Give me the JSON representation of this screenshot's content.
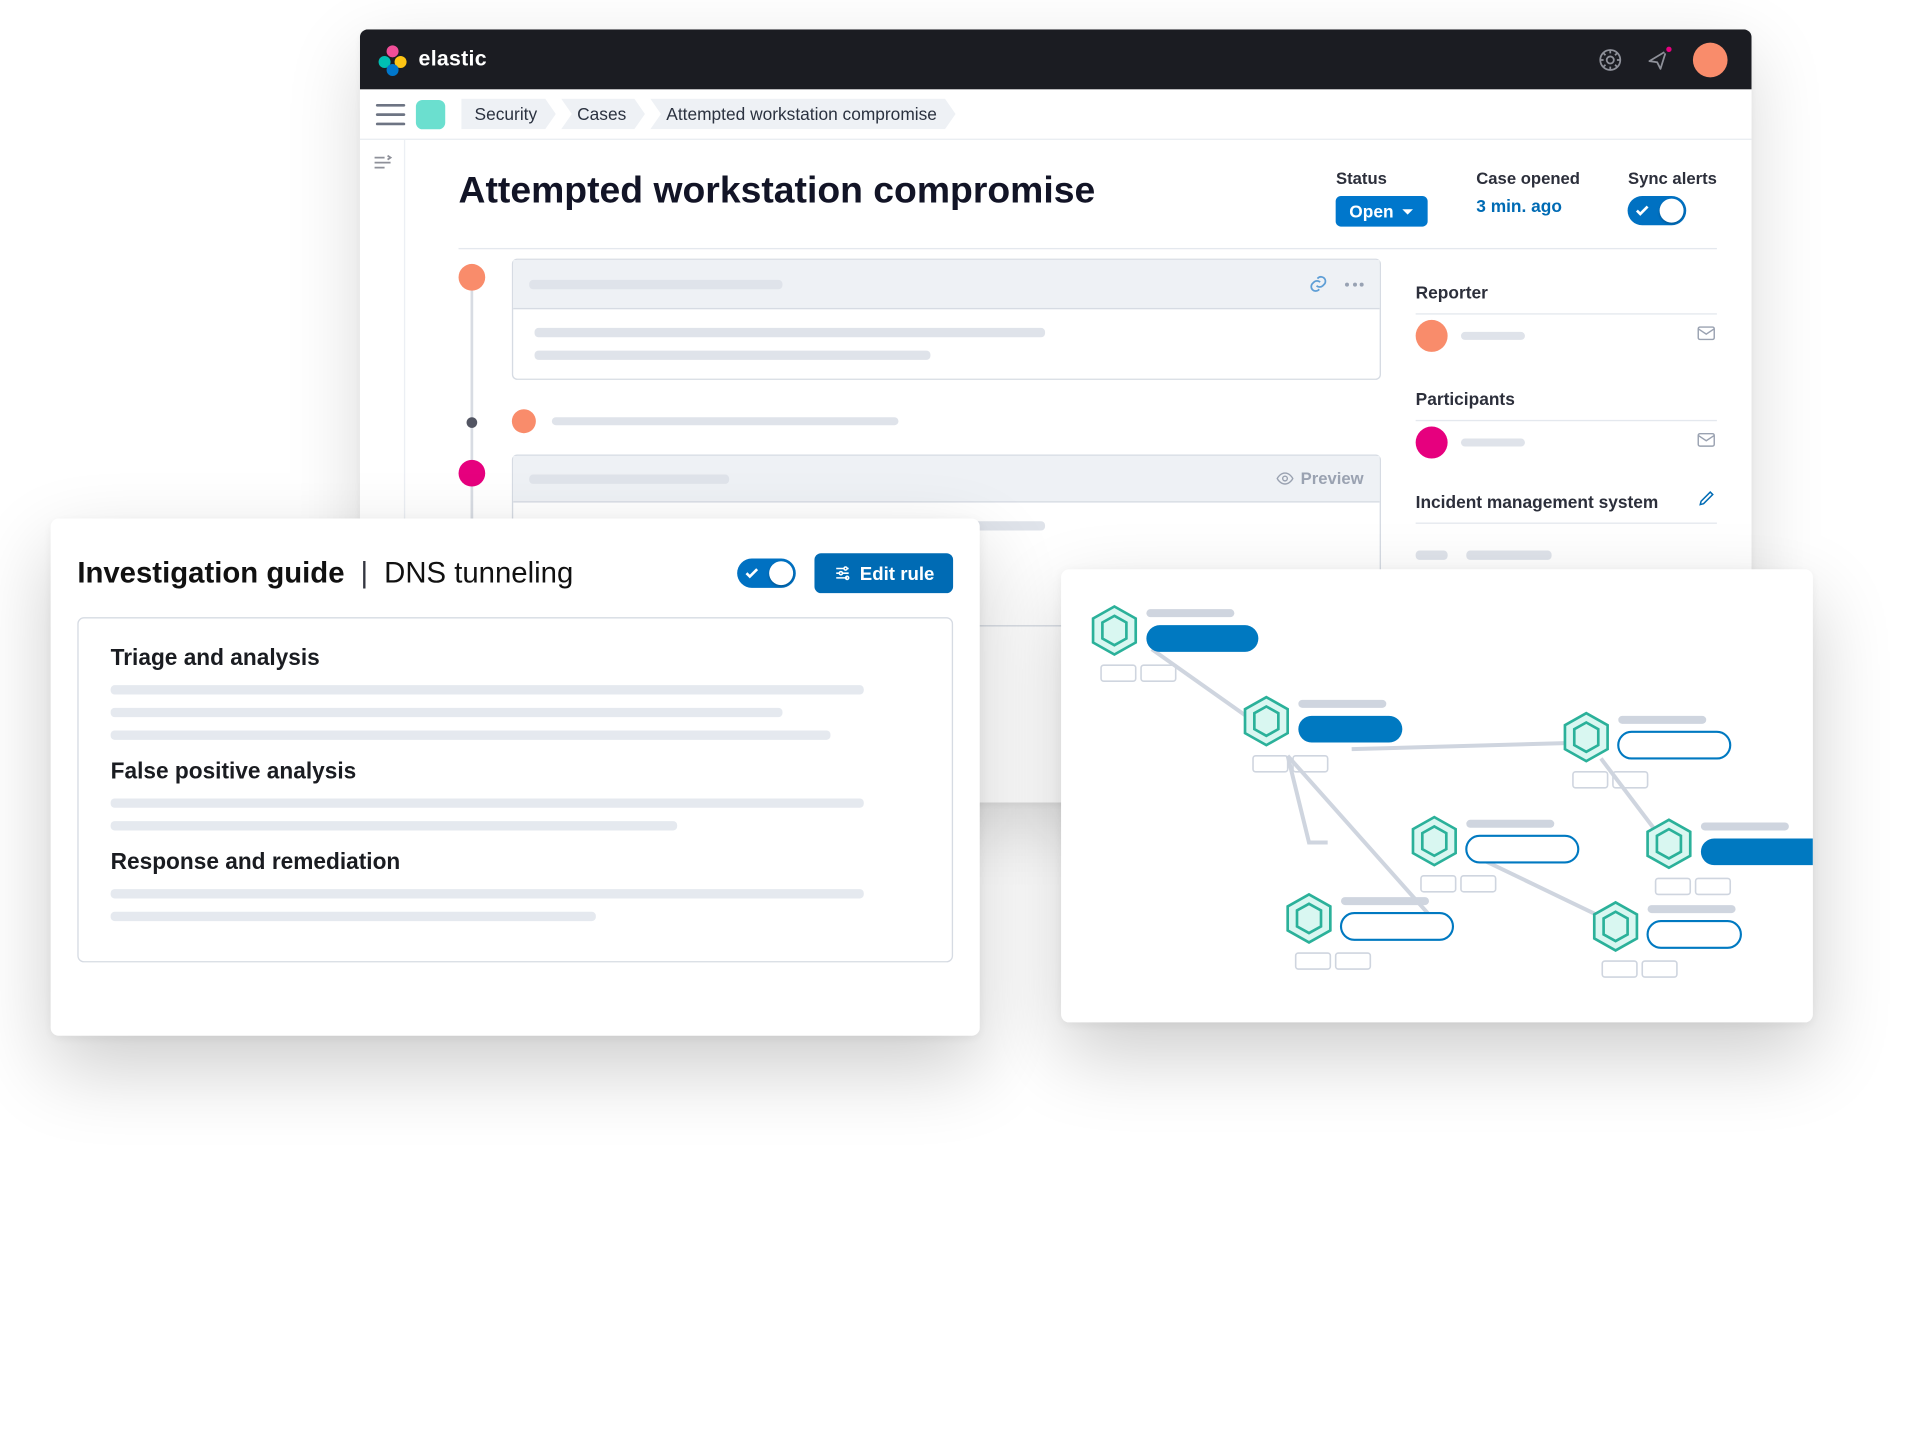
{
  "brand": {
    "name": "elastic"
  },
  "breadcrumbs": [
    "Security",
    "Cases",
    "Attempted workstation compromise"
  ],
  "page": {
    "title": "Attempted workstation compromise",
    "status_label": "Status",
    "status_value": "Open",
    "opened_label": "Case opened",
    "opened_value": "3 min. ago",
    "sync_label": "Sync alerts",
    "preview_label": "Preview"
  },
  "sidebar": {
    "reporter_label": "Reporter",
    "participants_label": "Participants",
    "incident_label": "Incident management system"
  },
  "guide": {
    "title": "Investigation guide",
    "subtitle": "DNS tunneling",
    "edit_label": "Edit rule",
    "sections": {
      "s1": "Triage and analysis",
      "s2": "False positive analysis",
      "s3": "Response and remediation"
    }
  }
}
